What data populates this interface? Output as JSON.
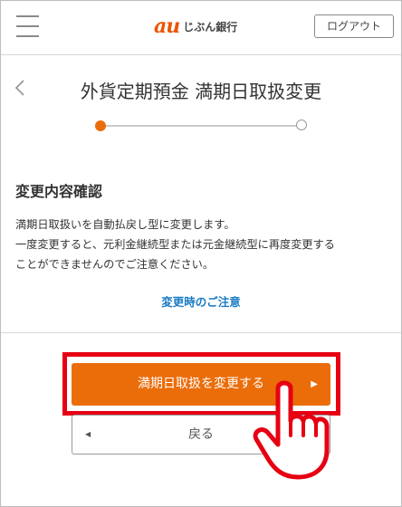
{
  "header": {
    "logo_mark": "au",
    "logo_text": "じぶん銀行",
    "logout_label": "ログアウト"
  },
  "page": {
    "title": "外貨定期預金 満期日取扱変更",
    "section_heading": "変更内容確認",
    "body_lines": [
      "満期日取扱いを自動払戻し型に変更します。",
      "一度変更すると、元利金継続型または元金継続型に再度変更する",
      "ことができませんのでご注意ください。"
    ],
    "notice_link": "変更時のご注意"
  },
  "stepper": {
    "current_step": 1,
    "total_steps": 2
  },
  "actions": {
    "primary_label": "満期日取扱を変更する",
    "secondary_label": "戻る"
  },
  "icons": {
    "menu": "hamburger-icon",
    "back": "chevron-left-icon",
    "primary_arrow": "triangle-right-icon",
    "secondary_arrow": "triangle-left-icon",
    "pointer": "pointing-hand-icon"
  },
  "colors": {
    "brand_orange": "#eb6d0a",
    "highlight_red": "#e60012",
    "link_blue": "#1a7cc5"
  }
}
